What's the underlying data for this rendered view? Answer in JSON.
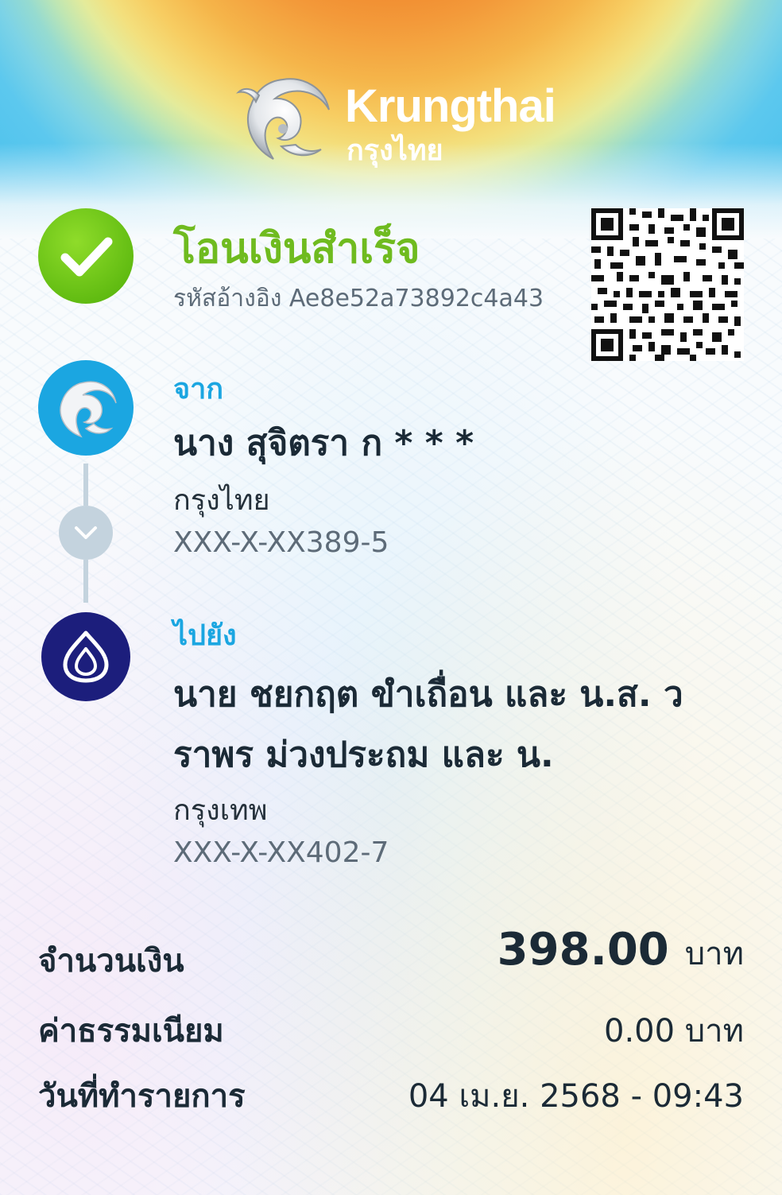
{
  "brand": {
    "name_en": "Krungthai",
    "name_th": "กรุงไทย",
    "colors": {
      "success_green": "#6fbb1f",
      "ktb_blue": "#1ba6e1",
      "bbl_navy": "#1c1e7c",
      "text_dark": "#1b2a36",
      "text_gray": "#5d6b78"
    }
  },
  "status": {
    "title": "โอนเงินสำเร็จ",
    "reference": "รหัสอ้างอิง Ae8e52a73892c4a43",
    "icon": "check-icon",
    "qr_icon": "qr-code-icon"
  },
  "sender": {
    "label": "จาก",
    "name": "นาง สุจิตรา ก * * *",
    "bank": "กรุงไทย",
    "account": "XXX-X-XX389-5",
    "icon": "krungthai-logo-icon"
  },
  "flow_icon": "chevron-down-icon",
  "receiver": {
    "label": "ไปยัง",
    "name_line1": "นาย ชยกฤต ขำเถื่อน และ น.ส. ว",
    "name_line2": "ราพร ม่วงประถม และ น.",
    "bank": "กรุงเทพ",
    "account": "XXX-X-XX402-7",
    "icon": "bangkok-bank-logo-icon"
  },
  "summary": {
    "amount_label": "จำนวนเงิน",
    "amount_value": "398.00",
    "amount_unit": "บาท",
    "fee_label": "ค่าธรรมเนียม",
    "fee_value": "0.00 บาท",
    "date_label": "วันที่ทำรายการ",
    "date_value": "04 เม.ย. 2568 - 09:43"
  }
}
